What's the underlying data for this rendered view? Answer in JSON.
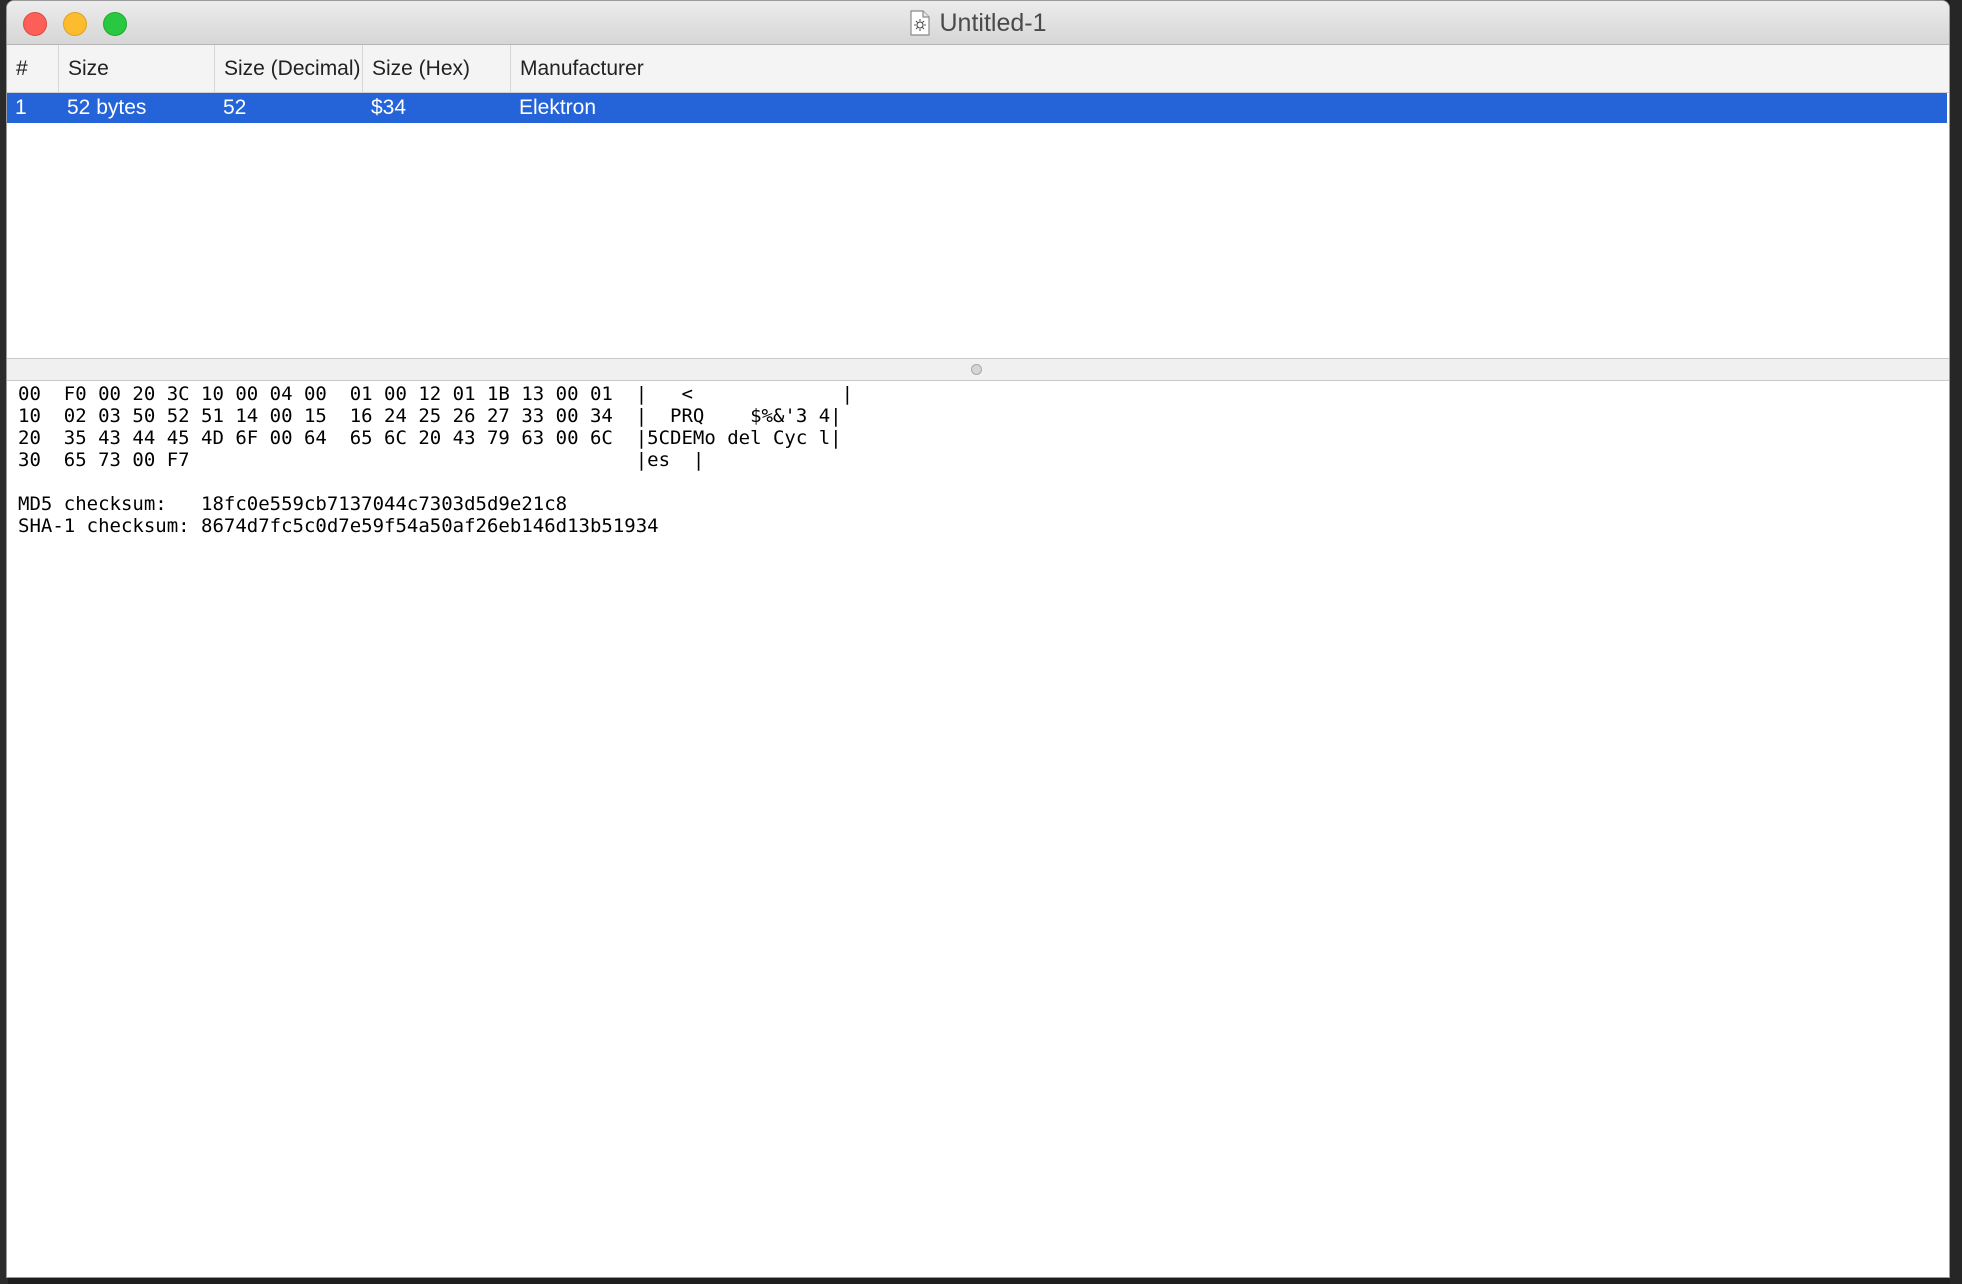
{
  "window": {
    "title": "Untitled-1"
  },
  "table": {
    "columns": [
      "#",
      "Size",
      "Size (Decimal)",
      "Size (Hex)",
      "Manufacturer"
    ],
    "rows": [
      {
        "index": "1",
        "size": "52 bytes",
        "size_decimal": "52",
        "size_hex": "$34",
        "manufacturer": "Elektron",
        "selected": true
      }
    ]
  },
  "hex_dump": {
    "lines": [
      "00  F0 00 20 3C 10 00 04 00  01 00 12 01 1B 13 00 01  |   <             |",
      "10  02 03 50 52 51 14 00 15  16 24 25 26 27 33 00 34  |  PRQ    $%&'3 4|",
      "20  35 43 44 45 4D 6F 00 64  65 6C 20 43 79 63 00 6C  |5CDEMo del Cyc l|",
      "30  65 73 00 F7                                       |es  |",
      "",
      "MD5 checksum:   18fc0e559cb7137044c7303d5d9e21c8",
      "SHA-1 checksum: 8674d7fc5c0d7e59f54a50af26eb146d13b51934"
    ]
  },
  "colors": {
    "selection": "#2463d8",
    "close": "#fc5f57",
    "minimize": "#fdbc2e",
    "zoom": "#28c840"
  },
  "icons": {
    "document": "document-icon"
  }
}
